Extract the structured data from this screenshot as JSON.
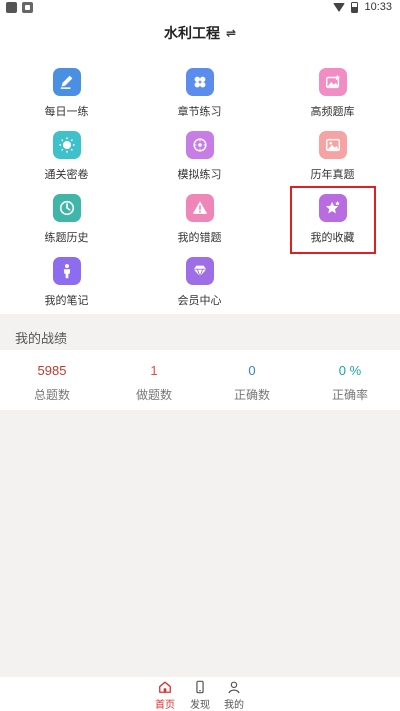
{
  "status_bar": {
    "time": "10:33"
  },
  "header": {
    "title": "水利工程",
    "switch_icon": "⇌"
  },
  "grid": [
    {
      "label": "每日一练",
      "icon": "pencil-icon",
      "color": "#4a90e2"
    },
    {
      "label": "章节练习",
      "icon": "grid-icon",
      "color": "#5b8def"
    },
    {
      "label": "高频题库",
      "icon": "image-star-icon",
      "color": "#f28cc4"
    },
    {
      "label": "通关密卷",
      "icon": "sun-icon",
      "color": "#3fc1c9"
    },
    {
      "label": "模拟练习",
      "icon": "dial-icon",
      "color": "#c77ce6"
    },
    {
      "label": "历年真题",
      "icon": "picture-icon",
      "color": "#f5a3a3"
    },
    {
      "label": "练题历史",
      "icon": "clock-icon",
      "color": "#3fb6a8"
    },
    {
      "label": "我的错题",
      "icon": "warning-icon",
      "color": "#ef86b8"
    },
    {
      "label": "我的收藏",
      "icon": "star-icon",
      "color": "#b86ce0"
    },
    {
      "label": "我的笔记",
      "icon": "person-icon",
      "color": "#8e6cf0"
    },
    {
      "label": "会员中心",
      "icon": "diamond-icon",
      "color": "#9d6ee6"
    }
  ],
  "stats": {
    "title": "我的战绩",
    "items": [
      {
        "value": "5985",
        "label": "总题数",
        "color": "#c0392b"
      },
      {
        "value": "1",
        "label": "做题数",
        "color": "#e74c3c"
      },
      {
        "value": "0",
        "label": "正确数",
        "color": "#2e86c1"
      },
      {
        "value": "0 %",
        "label": "正确率",
        "color": "#17a2b8"
      }
    ]
  },
  "bottom_nav": [
    {
      "label": "首页",
      "icon": "home-icon",
      "active": true
    },
    {
      "label": "发现",
      "icon": "phone-icon",
      "active": false
    },
    {
      "label": "我的",
      "icon": "user-icon",
      "active": false
    }
  ]
}
